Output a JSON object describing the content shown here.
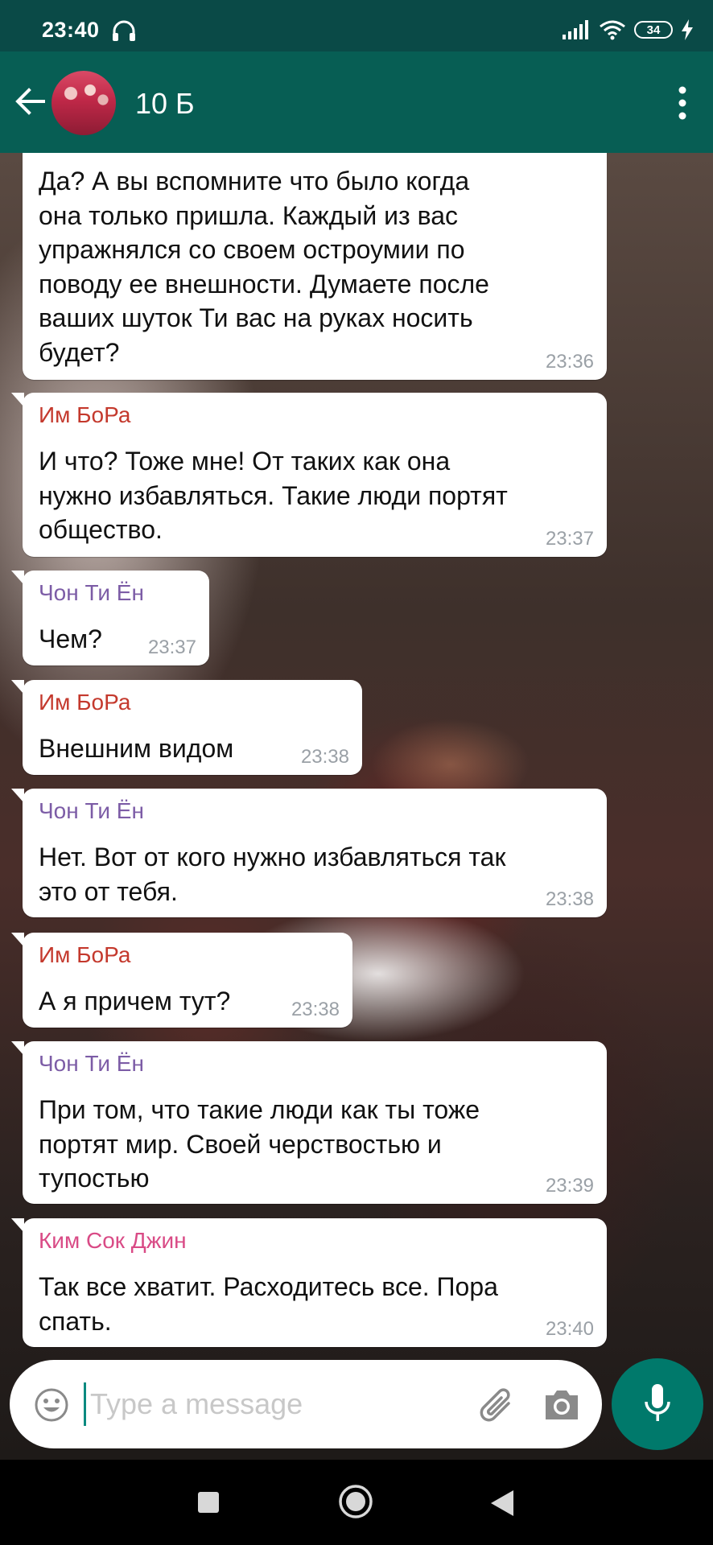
{
  "status_bar": {
    "time": "23:40",
    "battery": "34"
  },
  "header": {
    "title": "10 Б"
  },
  "messages": [
    {
      "text": "Да? А вы вспомните что было когда\nона только пришла. Каждый из вас\nупражнялся со своем остроумии по\nповоду ее внешности. Думаете после\nваших шуток Ти вас на руках носить\nбудет?",
      "time": "23:36"
    },
    {
      "sender": "Им БоРа",
      "text": "И что? Тоже мне! От таких как она\nнужно избавляться. Такие люди портят\nобщество.",
      "time": "23:37"
    },
    {
      "sender": "Чон Ти Ён",
      "text": "Чем?",
      "time": "23:37"
    },
    {
      "sender": "Им БоРа",
      "text": "Внешним видом",
      "time": "23:38"
    },
    {
      "sender": "Чон Ти Ён",
      "text": "Нет. Вот от кого нужно избавляться так\nэто от тебя.",
      "time": "23:38"
    },
    {
      "sender": "Им БоРа",
      "text": "А я причем тут?",
      "time": "23:38"
    },
    {
      "sender": "Чон Ти Ён",
      "text": "При том, что такие люди как ты тоже\nпортят мир. Своей черствостью и\nтупостью",
      "time": "23:39"
    },
    {
      "sender": "Ким Сок Джин",
      "text": "Так все хватит. Расходитесь все. Пора\nспать.",
      "time": "23:40"
    }
  ],
  "input": {
    "placeholder": "Type a message"
  },
  "colors": {
    "header": "#075e54",
    "accent": "#00796b",
    "sender_im_bora": "#c4392d",
    "sender_chon_ti_yon": "#7c5ca6",
    "sender_kim_sok_jin": "#d94b86"
  },
  "icons": [
    "back-arrow-icon",
    "more-vert-icon",
    "emoji-icon",
    "attach-icon",
    "camera-icon",
    "mic-icon",
    "headset-icon",
    "signal-icon",
    "wifi-icon",
    "charging-icon"
  ]
}
